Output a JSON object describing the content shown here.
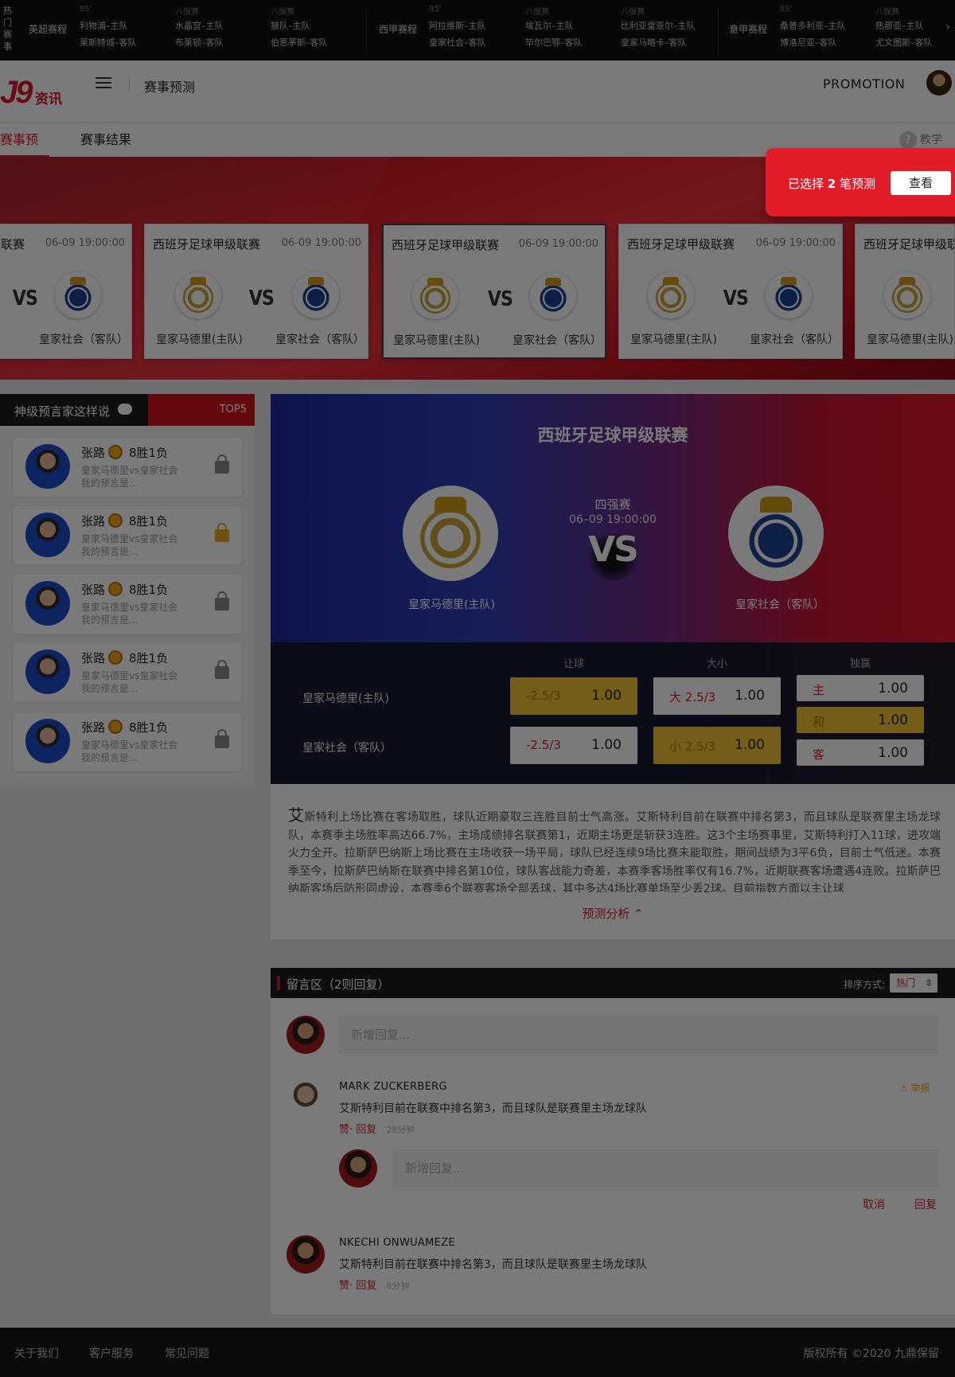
{
  "ticker": {
    "hot_label": "热门赛事",
    "groups": [
      {
        "league": "英超赛程",
        "matches": [
          {
            "minute": "85'",
            "home": "利物浦–主队",
            "away": "莱斯特城–客队"
          },
          {
            "minute": "八强赛",
            "home": "水晶宫–主队",
            "away": "布莱顿–客队"
          },
          {
            "minute": "八强赛",
            "home": "狼队–主队",
            "away": "伯恩茅斯–客队"
          }
        ]
      },
      {
        "league": "西甲赛程",
        "matches": [
          {
            "minute": "85'",
            "home": "阿拉维斯–主队",
            "away": "皇家社会–客队"
          },
          {
            "minute": "八强赛",
            "home": "埃瓦尔–主队",
            "away": "毕尔巴鄂–客队"
          },
          {
            "minute": "八强赛",
            "home": "比利亚雷亚尔–主队",
            "away": "皇家马略卡–客队"
          }
        ]
      },
      {
        "league": "意甲赛程",
        "matches": [
          {
            "minute": "85'",
            "home": "桑普多利亚–主队",
            "away": "博洛尼亚–客队"
          },
          {
            "minute": "八强赛",
            "home": "热那亚–主队",
            "away": "尤文图斯–客队"
          }
        ]
      }
    ],
    "next_icon": "chevron-right-icon"
  },
  "header": {
    "logo_text": "资讯",
    "title": "赛事预测",
    "promotion": "PROMOTION"
  },
  "tabs": {
    "items": [
      "赛事预测",
      "赛事结果"
    ],
    "active": 0,
    "help": "教学"
  },
  "banner": {
    "cards": [
      {
        "league": "联赛",
        "time": "06-09  19:00:00",
        "vs": "VS",
        "home": "",
        "away": "皇家社会（客队）"
      },
      {
        "league": "西班牙足球甲级联赛",
        "time": "06-09  19:00:00",
        "vs": "VS",
        "home": "皇家马德里(主队)",
        "away": "皇家社会（客队）"
      },
      {
        "league": "西班牙足球甲级联赛",
        "time": "06-09  19:00:00",
        "vs": "VS",
        "home": "皇家马德里(主队)",
        "away": "皇家社会（客队）"
      },
      {
        "league": "西班牙足球甲级联赛",
        "time": "06-09  19:00:00",
        "vs": "VS",
        "home": "皇家马德里(主队)",
        "away": "皇家社会（客队）"
      },
      {
        "league": "西班牙足球甲级联赛",
        "time": "",
        "vs": "",
        "home": "皇家马德里(主队)",
        "away": ""
      }
    ],
    "selection": {
      "prefix": "已选择 ",
      "count": "2",
      "suffix": " 笔预测",
      "button": "查看"
    }
  },
  "prophets": {
    "title": "神级预言家这样说",
    "top": "TOP5",
    "items": [
      {
        "name": "张路",
        "record": "8胜1负",
        "match": "皇家马德里vs皇家社会",
        "preview": "我的预言是...",
        "lock": "gray"
      },
      {
        "name": "张路",
        "record": "8胜1负",
        "match": "皇家马德里vs皇家社会",
        "preview": "我的预言是...",
        "lock": "gold"
      },
      {
        "name": "张路",
        "record": "8胜1负",
        "match": "皇家马德里vs皇家社会",
        "preview": "我的预言是...",
        "lock": "gray"
      },
      {
        "name": "张路",
        "record": "8胜1负",
        "match": "皇家马德里vs皇家社会",
        "preview": "我的预言是...",
        "lock": "gray"
      },
      {
        "name": "张路",
        "record": "8胜1负",
        "match": "皇家马德里vs皇家社会",
        "preview": "我的预言是...",
        "lock": "gray"
      }
    ]
  },
  "match": {
    "league": "西班牙足球甲级联赛",
    "stage": "四强赛",
    "time": "06–09 19:00:00",
    "vs": "VS",
    "home": "皇家马德里(主队)",
    "away": "皇家社会（客队）"
  },
  "odds": {
    "headers": [
      "让球",
      "大小",
      "独赢"
    ],
    "rows": [
      {
        "team": "皇家马德里(主队)",
        "handicap": {
          "label": "-2.5/3",
          "value": "1.00",
          "selected": true
        },
        "total": {
          "label": "大 2.5/3",
          "value": "1.00",
          "selected": false
        }
      },
      {
        "team": "皇家社会（客队）",
        "handicap": {
          "label": "-2.5/3",
          "value": "1.00",
          "selected": false
        },
        "total": {
          "label": "小 2.5/3",
          "value": "1.00",
          "selected": true
        }
      }
    ],
    "moneyline": [
      {
        "label": "主",
        "value": "1.00",
        "selected": false
      },
      {
        "label": "和",
        "value": "1.00",
        "selected": true
      },
      {
        "label": "客",
        "value": "1.00",
        "selected": false
      }
    ]
  },
  "analysis": {
    "text": "艾斯特利上场比赛在客场取胜，球队近期豪取三连胜目前士气高涨。艾斯特利目前在联赛中排名第3，而且球队是联赛里主场龙球队，本赛季主场胜率高达66.7%，主场成绩排名联赛第1，近期主场更是斩获3连胜。这3个主场赛事里，艾斯特利打入11球，进攻端火力全开。拉斯萨巴纳斯上场比赛在主场收获一场平局，球队已经连续9场比赛未能取胜，期间战绩为3平6负，目前士气低迷。本赛季至今，拉斯萨巴纳斯在联赛中排名第10位，球队客战能力奇差，本赛季客场胜率仅有16.7%，近期联赛客场遭遇4连败。拉斯萨巴纳斯客场后防形同虚设，本赛季6个联赛客场全部丢球，其中多达4场比赛单场至少丢2球。目前指数方面以主让球",
    "toggle": "预测分析 ⌃"
  },
  "comments": {
    "title": "留言区（2则回复）",
    "sort_label": "排序方式:",
    "sort_value": "热门",
    "input_placeholder": "新增回复...",
    "items": [
      {
        "author": "MARK ZUCKERBERG",
        "text": "艾斯特利目前在联赛中排名第3，而且球队是联赛里主场龙球队",
        "like": "赞",
        "reply": "回复",
        "time": "28分钟",
        "report": "举报"
      },
      {
        "author": "NKECHI ONWUAMEZE",
        "text": "艾斯特利目前在联赛中排名第3，而且球队是联赛里主场龙球队",
        "like": "赞",
        "reply": "回复",
        "time": "8分钟"
      }
    ],
    "reply_placeholder": "新增回复...",
    "cancel": "取消",
    "submit": "回复"
  },
  "footer": {
    "links": [
      "关于我们",
      "客户服务",
      "常见问题"
    ],
    "copyright": "版权所有 ©2020 九鼎保留"
  },
  "colors": {
    "accent": "#d81e2a",
    "gold": "#f1c232",
    "dark": "#1c1c22"
  }
}
